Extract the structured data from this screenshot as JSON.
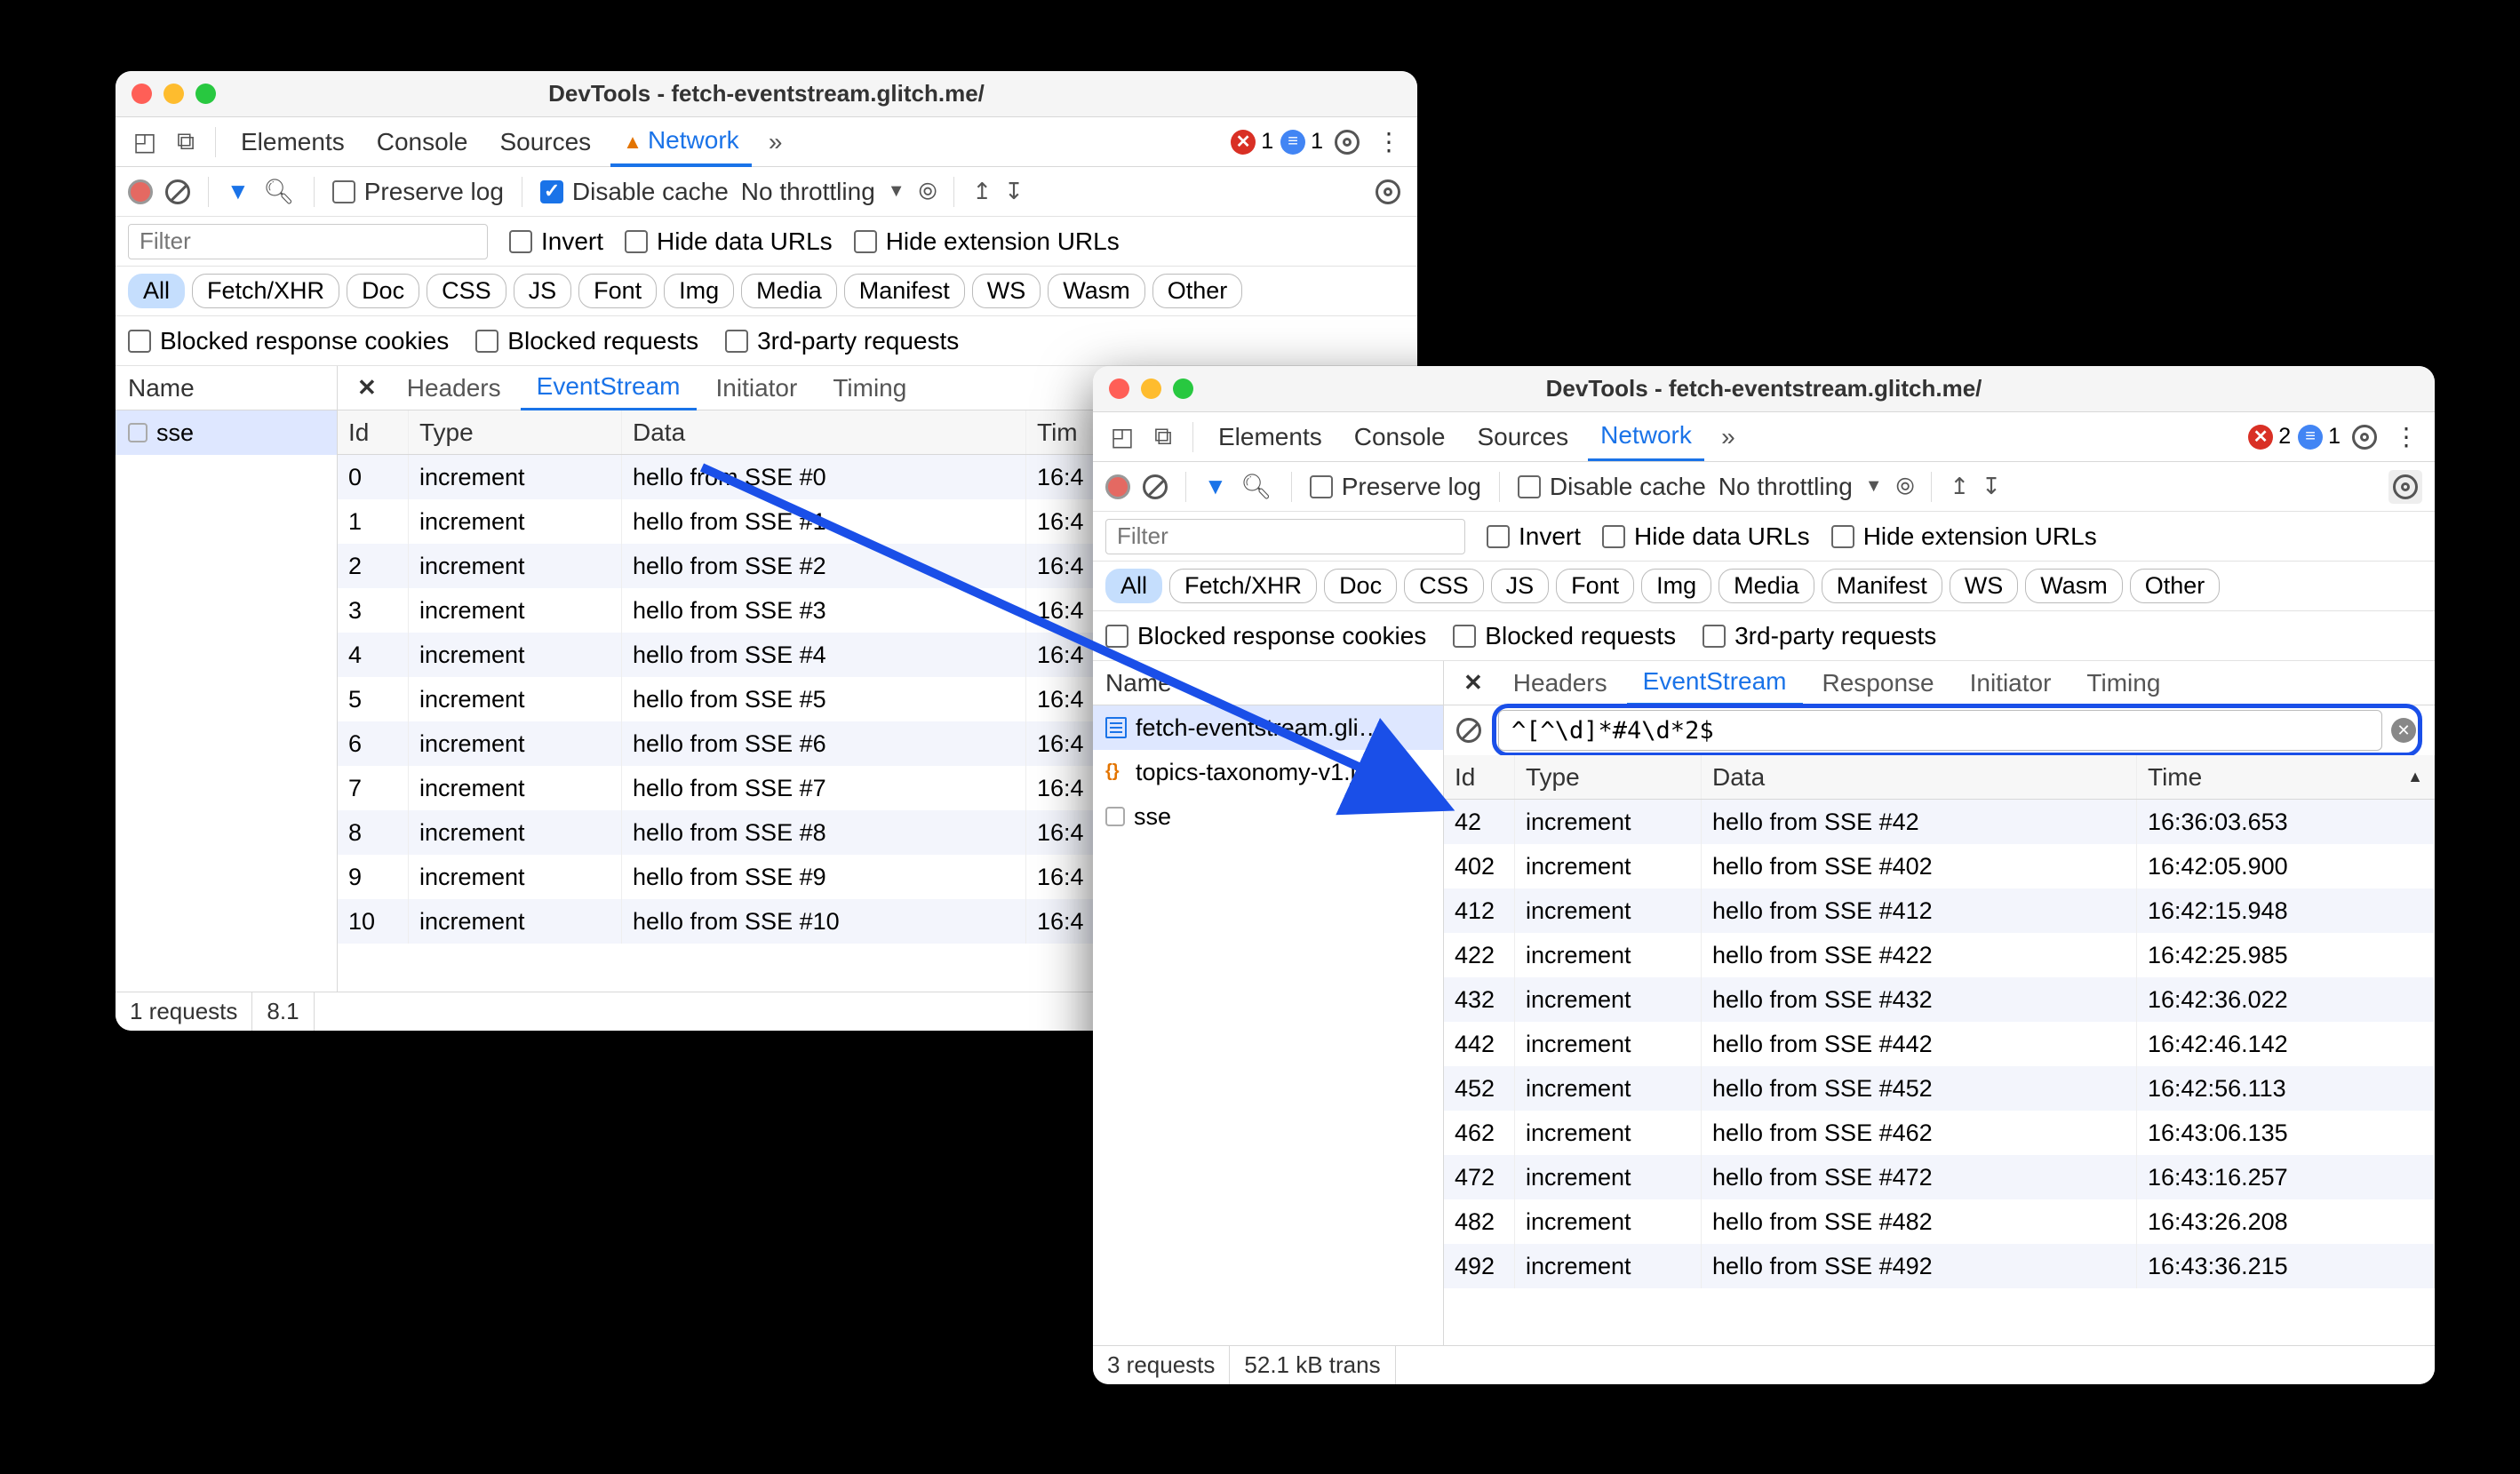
{
  "window1": {
    "title": "DevTools - fetch-eventstream.glitch.me/",
    "main_tabs": {
      "elements": "Elements",
      "console": "Console",
      "sources": "Sources",
      "network": "Network"
    },
    "err_count": "1",
    "info_count": "1",
    "toolbar": {
      "preserve": "Preserve log",
      "disable_cache": "Disable cache",
      "throttling": "No throttling"
    },
    "filter": {
      "placeholder": "Filter",
      "invert": "Invert",
      "hide_urls": "Hide data URLs",
      "hide_ext": "Hide extension URLs"
    },
    "pills": [
      "All",
      "Fetch/XHR",
      "Doc",
      "CSS",
      "JS",
      "Font",
      "Img",
      "Media",
      "Manifest",
      "WS",
      "Wasm",
      "Other"
    ],
    "checks": {
      "blocked_cookies": "Blocked response cookies",
      "blocked_req": "Blocked requests",
      "third": "3rd-party requests"
    },
    "name_hdr": "Name",
    "names": [
      {
        "label": "sse",
        "icon": "frame"
      }
    ],
    "det_tabs": {
      "headers": "Headers",
      "eventstream": "EventStream",
      "initiator": "Initiator",
      "timing": "Timing"
    },
    "cols": {
      "id": "Id",
      "type": "Type",
      "data": "Data",
      "time": "Tim"
    },
    "rows": [
      {
        "id": "0",
        "type": "increment",
        "data": "hello from SSE #0",
        "time": "16:4"
      },
      {
        "id": "1",
        "type": "increment",
        "data": "hello from SSE #1",
        "time": "16:4"
      },
      {
        "id": "2",
        "type": "increment",
        "data": "hello from SSE #2",
        "time": "16:4"
      },
      {
        "id": "3",
        "type": "increment",
        "data": "hello from SSE #3",
        "time": "16:4"
      },
      {
        "id": "4",
        "type": "increment",
        "data": "hello from SSE #4",
        "time": "16:4"
      },
      {
        "id": "5",
        "type": "increment",
        "data": "hello from SSE #5",
        "time": "16:4"
      },
      {
        "id": "6",
        "type": "increment",
        "data": "hello from SSE #6",
        "time": "16:4"
      },
      {
        "id": "7",
        "type": "increment",
        "data": "hello from SSE #7",
        "time": "16:4"
      },
      {
        "id": "8",
        "type": "increment",
        "data": "hello from SSE #8",
        "time": "16:4"
      },
      {
        "id": "9",
        "type": "increment",
        "data": "hello from SSE #9",
        "time": "16:4"
      },
      {
        "id": "10",
        "type": "increment",
        "data": "hello from SSE #10",
        "time": "16:4"
      }
    ],
    "status": {
      "requests": "1 requests",
      "size": "8.1"
    }
  },
  "window2": {
    "title": "DevTools - fetch-eventstream.glitch.me/",
    "main_tabs": {
      "elements": "Elements",
      "console": "Console",
      "sources": "Sources",
      "network": "Network"
    },
    "err_count": "2",
    "info_count": "1",
    "toolbar": {
      "preserve": "Preserve log",
      "disable_cache": "Disable cache",
      "throttling": "No throttling"
    },
    "filter": {
      "placeholder": "Filter",
      "invert": "Invert",
      "hide_urls": "Hide data URLs",
      "hide_ext": "Hide extension URLs"
    },
    "pills": [
      "All",
      "Fetch/XHR",
      "Doc",
      "CSS",
      "JS",
      "Font",
      "Img",
      "Media",
      "Manifest",
      "WS",
      "Wasm",
      "Other"
    ],
    "checks": {
      "blocked_cookies": "Blocked response cookies",
      "blocked_req": "Blocked requests",
      "third": "3rd-party requests"
    },
    "name_hdr": "Name",
    "names": [
      {
        "label": "fetch-eventstream.gli…",
        "icon": "doc"
      },
      {
        "label": "topics-taxonomy-v1.j…",
        "icon": "js"
      },
      {
        "label": "sse",
        "icon": "frame"
      }
    ],
    "det_tabs": {
      "headers": "Headers",
      "eventstream": "EventStream",
      "response": "Response",
      "initiator": "Initiator",
      "timing": "Timing"
    },
    "regex": "^[^\\d]*#4\\d*2$",
    "cols": {
      "id": "Id",
      "type": "Type",
      "data": "Data",
      "time": "Time"
    },
    "rows": [
      {
        "id": "42",
        "type": "increment",
        "data": "hello from SSE #42",
        "time": "16:36:03.653"
      },
      {
        "id": "402",
        "type": "increment",
        "data": "hello from SSE #402",
        "time": "16:42:05.900"
      },
      {
        "id": "412",
        "type": "increment",
        "data": "hello from SSE #412",
        "time": "16:42:15.948"
      },
      {
        "id": "422",
        "type": "increment",
        "data": "hello from SSE #422",
        "time": "16:42:25.985"
      },
      {
        "id": "432",
        "type": "increment",
        "data": "hello from SSE #432",
        "time": "16:42:36.022"
      },
      {
        "id": "442",
        "type": "increment",
        "data": "hello from SSE #442",
        "time": "16:42:46.142"
      },
      {
        "id": "452",
        "type": "increment",
        "data": "hello from SSE #452",
        "time": "16:42:56.113"
      },
      {
        "id": "462",
        "type": "increment",
        "data": "hello from SSE #462",
        "time": "16:43:06.135"
      },
      {
        "id": "472",
        "type": "increment",
        "data": "hello from SSE #472",
        "time": "16:43:16.257"
      },
      {
        "id": "482",
        "type": "increment",
        "data": "hello from SSE #482",
        "time": "16:43:26.208"
      },
      {
        "id": "492",
        "type": "increment",
        "data": "hello from SSE #492",
        "time": "16:43:36.215"
      }
    ],
    "status": {
      "requests": "3 requests",
      "size": "52.1 kB trans"
    }
  }
}
